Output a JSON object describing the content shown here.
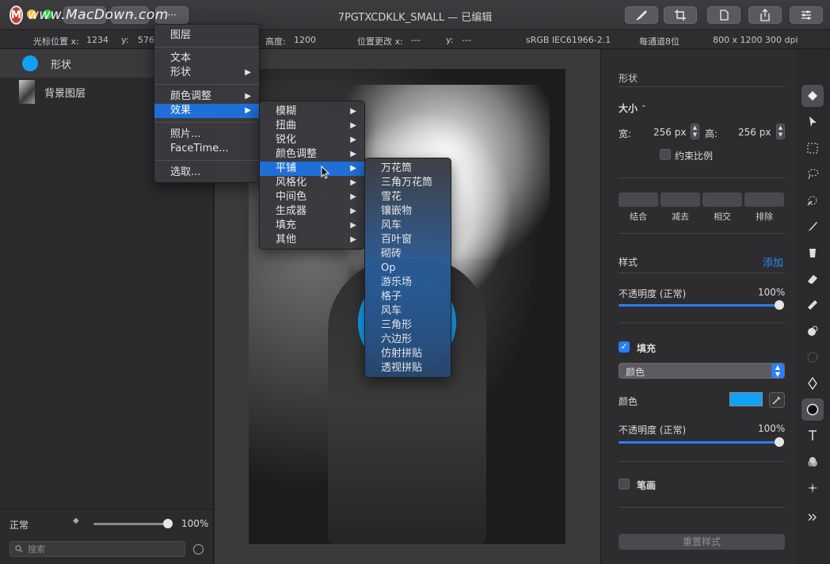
{
  "window": {
    "title": "7PGTXCDKLK_SMALL — 已编辑",
    "toolbar_left": [
      "···",
      "···",
      "···"
    ],
    "watermark_logo": "M",
    "watermark_text": "www.MacDown.com"
  },
  "infobar": {
    "cursor_label": "光标位置 x:",
    "cursor_x": "1234",
    "y_label": "y:",
    "cursor_y": "576",
    "height_label": "高度:",
    "height_value": "1200",
    "pos_change_label": "位置更改 x:",
    "pos_change_x": "---",
    "pos_change_y_label": "y:",
    "pos_change_y": "---",
    "color_profile": "sRGB IEC61966-2.1",
    "bit_depth": "每通道8位",
    "dimensions": "800 x 1200 300 dpi"
  },
  "layers": {
    "items": [
      {
        "name": "形状"
      },
      {
        "name": "背景图层"
      }
    ],
    "blend_mode": "正常",
    "opacity": "100%",
    "search_placeholder": "搜索"
  },
  "main_menu": {
    "items": [
      "图层",
      "文本",
      "形状",
      "颜色调整",
      "效果",
      "照片...",
      "FaceTime...",
      "选取..."
    ],
    "selected": "效果"
  },
  "effects_menu": {
    "items": [
      "模糊",
      "扭曲",
      "锐化",
      "颜色调整",
      "平铺",
      "风格化",
      "中间色",
      "生成器",
      "填充",
      "其他"
    ],
    "selected": "平铺"
  },
  "tile_menu": {
    "items": [
      "万花筒",
      "三角万花筒",
      "雪花",
      "镶嵌物",
      "风车",
      "百叶窗",
      "砌砖",
      "Op",
      "游乐场",
      "格子",
      "风车",
      "三角形",
      "六边形",
      "仿射拼贴",
      "透视拼贴"
    ]
  },
  "inspector": {
    "section_title": "形状",
    "size_label": "大小",
    "width_label": "宽:",
    "width_value": "256 px",
    "height_label": "高:",
    "height_value": "256 px",
    "constrain_label": "约束比例",
    "bool_ops": [
      "结合",
      "减去",
      "相交",
      "排除"
    ],
    "style_label": "样式",
    "add_label": "添加",
    "opacity_label": "不透明度 (正常)",
    "opacity_value": "100%",
    "fill_label": "填充",
    "fill_type": "颜色",
    "color_label": "颜色",
    "fill_opacity_label": "不透明度 (正常)",
    "fill_opacity_value": "100%",
    "stroke_label": "笔画",
    "reset_label": "重置样式",
    "fill_color": "#12a0f6"
  },
  "tools": [
    "paint-bucket-icon",
    "arrow-icon",
    "rect-select-icon",
    "lasso-icon",
    "magic-icon",
    "brush-icon",
    "bucket-icon",
    "eraser-icon",
    "bandage-icon",
    "clone-icon",
    "blur-icon",
    "pen-icon",
    "shape-icon",
    "text-icon",
    "color-icon",
    "sparkle-icon",
    "more-icon"
  ]
}
